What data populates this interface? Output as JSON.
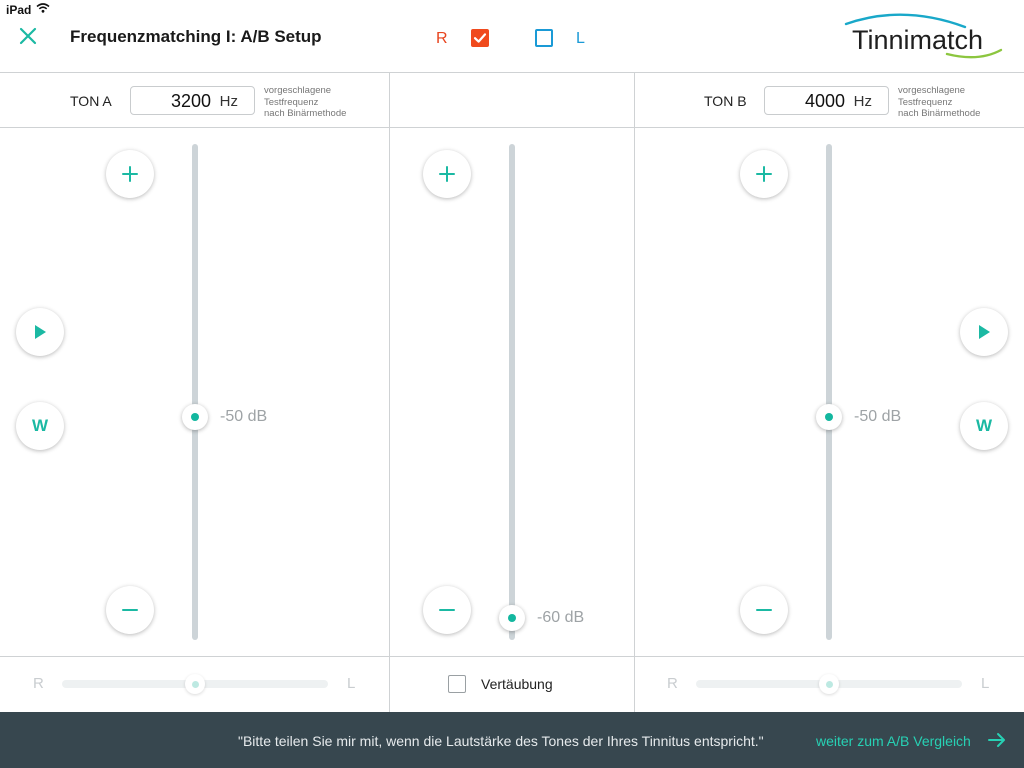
{
  "status_bar": {
    "device": "iPad",
    "wifi_icon": "wifi-icon"
  },
  "header": {
    "close_icon": "close-icon",
    "title": "Frequenzmatching I: A/B Setup",
    "ear_right": {
      "label": "R",
      "checked": true,
      "color": "#f04a1d"
    },
    "ear_left": {
      "label": "L",
      "checked": false,
      "color": "#1a9ad6"
    },
    "logo_text": "Tinnimatch"
  },
  "tone_a": {
    "label": "TON A",
    "frequency": "3200",
    "unit": "Hz",
    "hint": [
      "vorgeschlagene",
      "Testfrequenz",
      "nach Binärmethode"
    ],
    "volume_label": "-50 dB",
    "play_icon": "play-icon",
    "w_label": "W",
    "pan": {
      "left_label": "R",
      "right_label": "L",
      "value": 0.5
    }
  },
  "masking": {
    "volume_label": "-60 dB",
    "checkbox_label": "Vertäubung",
    "checked": false
  },
  "tone_b": {
    "label": "TON B",
    "frequency": "4000",
    "unit": "Hz",
    "hint": [
      "vorgeschlagene",
      "Testfrequenz",
      "nach Binärmethode"
    ],
    "volume_label": "-50 dB",
    "play_icon": "play-icon",
    "w_label": "W",
    "pan": {
      "left_label": "R",
      "right_label": "L",
      "value": 0.5
    }
  },
  "footer": {
    "quote": "\"Bitte teilen Sie mir mit, wenn die Lautstärke des Tones der Ihres Tinnitus entspricht.\"",
    "next_label": "weiter zum A/B Vergleich",
    "next_icon": "arrow-right-icon"
  },
  "colors": {
    "accent": "#1bb9a3",
    "footer_bg": "#37474f",
    "link": "#27d1b4"
  }
}
